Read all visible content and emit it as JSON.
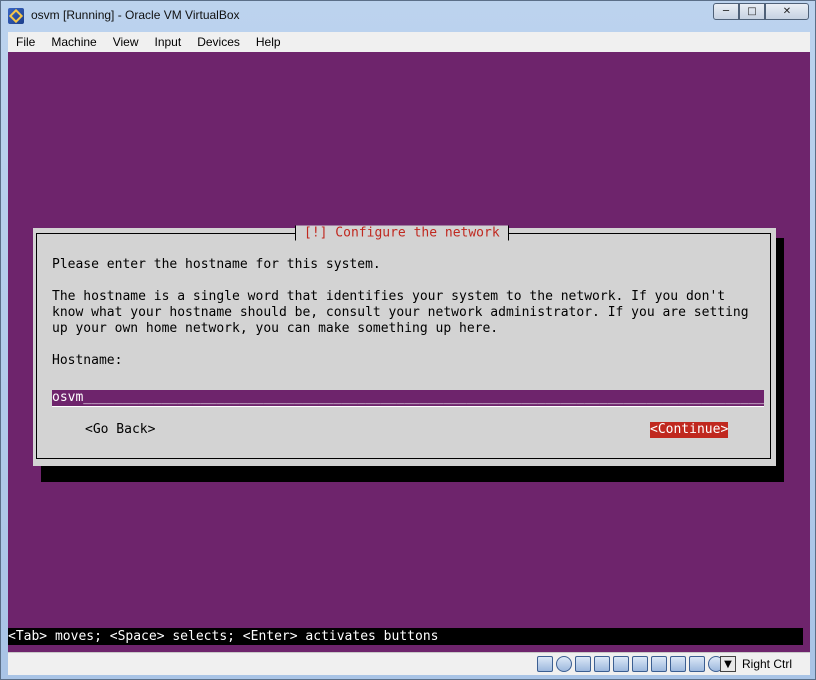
{
  "window": {
    "title": "osvm [Running] - Oracle VM VirtualBox",
    "controls": {
      "minimize": "─",
      "maximize": "□",
      "close": "✕"
    }
  },
  "menu": [
    "File",
    "Machine",
    "View",
    "Input",
    "Devices",
    "Help"
  ],
  "installer": {
    "dialog_title": "[!] Configure the network",
    "prompt": "Please enter the hostname for this system.",
    "description": [
      "The hostname is a single word that identifies your system to the network. If you don't",
      "know what your hostname should be, consult your network administrator. If you are setting",
      "up your own home network, you can make something up here."
    ],
    "hostname_label": "Hostname:",
    "hostname_value": "osvm",
    "back_button": "<Go Back>",
    "continue_button": "<Continue>",
    "help_line": "<Tab> moves; <Space> selects; <Enter> activates buttons"
  },
  "statusbar": {
    "icons": [
      "hard-disk-icon",
      "optical-drive-icon",
      "usb-icon",
      "network-icon",
      "shared-folders-icon",
      "display-icon",
      "video-capture-icon",
      "audio-icon",
      "mouse-integration-icon",
      "cpu-icon",
      "keyboard-capture-icon"
    ],
    "host_key": "Right Ctrl"
  },
  "colors": {
    "vm_background": "#6e246c",
    "dialog_background": "#d3d3d3",
    "accent_red": "#c0281f"
  }
}
